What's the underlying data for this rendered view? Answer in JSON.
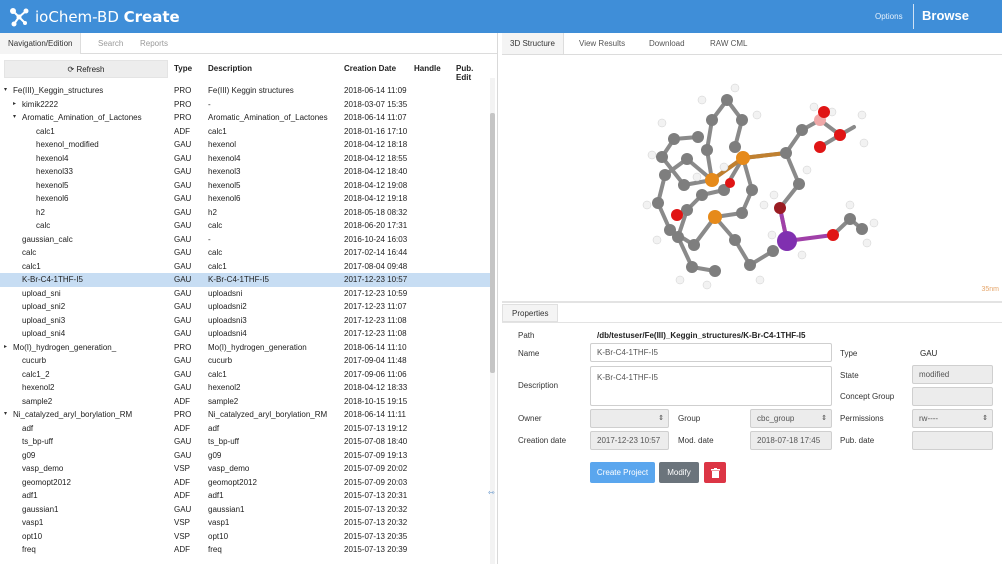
{
  "header": {
    "brand_regular": "ioChem-BD ",
    "brand_bold": "Create",
    "options": "Options",
    "browse": "Browse"
  },
  "left_tabs": [
    "Navigation/Edition",
    "Search",
    "Reports"
  ],
  "columns": {
    "refresh": "Refresh",
    "type": "Type",
    "description": "Description",
    "creation_date": "Creation Date",
    "handle": "Handle",
    "pub_edit": "Pub. Edit"
  },
  "rows": [
    {
      "arrow": "▾",
      "name": "Fe(III)_Keggin_structures",
      "type": "PRO",
      "desc": "Fe(III) Keggin structures",
      "date": "2018-06-14 11:09",
      "level": 0
    },
    {
      "arrow": "▸",
      "name": "kimik2222",
      "type": "PRO",
      "desc": "-",
      "date": "2018-03-07 15:35",
      "level": 1
    },
    {
      "arrow": "▾",
      "name": "Aromatic_Amination_of_Lactones",
      "type": "PRO",
      "desc": "Aromatic_Amination_of_Lactones",
      "date": "2018-06-14 11:07",
      "level": 1
    },
    {
      "arrow": "",
      "name": "calc1",
      "type": "ADF",
      "desc": "calc1",
      "date": "2018-01-16 17:10",
      "level": 2
    },
    {
      "arrow": "",
      "name": "hexenol_modified",
      "type": "GAU",
      "desc": "hexenol",
      "date": "2018-04-12 18:18",
      "level": 2
    },
    {
      "arrow": "",
      "name": "hexenol4",
      "type": "GAU",
      "desc": "hexenol4",
      "date": "2018-04-12 18:55",
      "level": 2
    },
    {
      "arrow": "",
      "name": "hexenol33",
      "type": "GAU",
      "desc": "hexenol3",
      "date": "2018-04-12 18:40",
      "level": 2
    },
    {
      "arrow": "",
      "name": "hexenol5",
      "type": "GAU",
      "desc": "hexenol5",
      "date": "2018-04-12 19:08",
      "level": 2
    },
    {
      "arrow": "",
      "name": "hexenol6",
      "type": "GAU",
      "desc": "hexenol6",
      "date": "2018-04-12 19:18",
      "level": 2
    },
    {
      "arrow": "",
      "name": "h2",
      "type": "GAU",
      "desc": "h2",
      "date": "2018-05-18 08:32",
      "level": 2
    },
    {
      "arrow": "",
      "name": "calc",
      "type": "GAU",
      "desc": "calc",
      "date": "2018-06-20 17:31",
      "level": 2
    },
    {
      "arrow": "",
      "name": "gaussian_calc",
      "type": "GAU",
      "desc": "-",
      "date": "2016-10-24 16:03",
      "level": 1
    },
    {
      "arrow": "",
      "name": "calc",
      "type": "GAU",
      "desc": "calc",
      "date": "2017-02-14 16:44",
      "level": 1
    },
    {
      "arrow": "",
      "name": "calc1",
      "type": "GAU",
      "desc": "calc1",
      "date": "2017-08-04 09:48",
      "level": 1
    },
    {
      "arrow": "",
      "name": "K-Br-C4-1THF-I5",
      "type": "GAU",
      "desc": "K-Br-C4-1THF-I5",
      "date": "2017-12-23 10:57",
      "level": 1,
      "selected": true
    },
    {
      "arrow": "",
      "name": "upload_sni",
      "type": "GAU",
      "desc": "uploadsni",
      "date": "2017-12-23 10:59",
      "level": 1
    },
    {
      "arrow": "",
      "name": "upload_sni2",
      "type": "GAU",
      "desc": "uploadsni2",
      "date": "2017-12-23 11:07",
      "level": 1
    },
    {
      "arrow": "",
      "name": "upload_sni3",
      "type": "GAU",
      "desc": "uploadsni3",
      "date": "2017-12-23 11:08",
      "level": 1
    },
    {
      "arrow": "",
      "name": "upload_sni4",
      "type": "GAU",
      "desc": "uploadsni4",
      "date": "2017-12-23 11:08",
      "level": 1
    },
    {
      "arrow": "▸",
      "name": "Mo(I)_hydrogen_generation_",
      "type": "PRO",
      "desc": "Mo(I)_hydrogen_generation",
      "date": "2018-06-14 11:10",
      "level": 0
    },
    {
      "arrow": "",
      "name": "cucurb",
      "type": "GAU",
      "desc": "cucurb",
      "date": "2017-09-04 11:48",
      "level": 1
    },
    {
      "arrow": "",
      "name": "calc1_2",
      "type": "GAU",
      "desc": "calc1",
      "date": "2017-09-06 11:06",
      "level": 1
    },
    {
      "arrow": "",
      "name": "hexenol2",
      "type": "GAU",
      "desc": "hexenol2",
      "date": "2018-04-12 18:33",
      "level": 1
    },
    {
      "arrow": "",
      "name": "sample2",
      "type": "ADF",
      "desc": "sample2",
      "date": "2018-10-15 19:15",
      "level": 1
    },
    {
      "arrow": "▾",
      "name": "Ni_catalyzed_aryl_borylation_RM",
      "type": "PRO",
      "desc": "Ni_catalyzed_aryl_borylation_RM",
      "date": "2018-06-14 11:11",
      "level": 0
    },
    {
      "arrow": "",
      "name": "adf",
      "type": "ADF",
      "desc": "adf",
      "date": "2015-07-13 19:12",
      "level": 1
    },
    {
      "arrow": "",
      "name": "ts_bp-uff",
      "type": "GAU",
      "desc": "ts_bp-uff",
      "date": "2015-07-08 18:40",
      "level": 1
    },
    {
      "arrow": "",
      "name": "g09",
      "type": "GAU",
      "desc": "g09",
      "date": "2015-07-09 19:13",
      "level": 1
    },
    {
      "arrow": "",
      "name": "vasp_demo",
      "type": "VSP",
      "desc": "vasp_demo",
      "date": "2015-07-09 20:02",
      "level": 1
    },
    {
      "arrow": "",
      "name": "geomopt2012",
      "type": "ADF",
      "desc": "geomopt2012",
      "date": "2015-07-09 20:03",
      "level": 1
    },
    {
      "arrow": "",
      "name": "adf1",
      "type": "ADF",
      "desc": "adf1",
      "date": "2015-07-13 20:31",
      "level": 1
    },
    {
      "arrow": "",
      "name": "gaussian1",
      "type": "GAU",
      "desc": "gaussian1",
      "date": "2015-07-13 20:32",
      "level": 1
    },
    {
      "arrow": "",
      "name": "vasp1",
      "type": "VSP",
      "desc": "vasp1",
      "date": "2015-07-13 20:32",
      "level": 1
    },
    {
      "arrow": "",
      "name": "opt10",
      "type": "VSP",
      "desc": "opt10",
      "date": "2015-07-13 20:35",
      "level": 1
    },
    {
      "arrow": "",
      "name": "freq",
      "type": "ADF",
      "desc": "freq",
      "date": "2015-07-13 20:39",
      "level": 1
    }
  ],
  "right_tabs": [
    "3D Structure",
    "View Results",
    "Download",
    "RAW CML"
  ],
  "viewer": {
    "scale_label": "35nm"
  },
  "properties": {
    "tab": "Properties",
    "path_label": "Path",
    "path_value": "/db/testuser/Fe(III)_Keggin_structures/K-Br-C4-1THF-I5",
    "name_label": "Name",
    "name_value": "K-Br-C4-1THF-I5",
    "type_label": "Type",
    "type_value": "GAU",
    "description_label": "Description",
    "description_value": "K-Br-C4-1THF-I5",
    "state_label": "State",
    "state_value": "modified",
    "concept_group_label": "Concept Group",
    "owner_label": "Owner",
    "group_label": "Group",
    "group_value": "cbc_group",
    "permissions_label": "Permissions",
    "permissions_value": "rw----",
    "creation_date_label": "Creation date",
    "creation_date_value": "2017-12-23 10:57",
    "mod_date_label": "Mod. date",
    "mod_date_value": "2018-07-18 17:45",
    "pub_date_label": "Pub. date",
    "create_project": "Create Project",
    "modify": "Modify"
  }
}
